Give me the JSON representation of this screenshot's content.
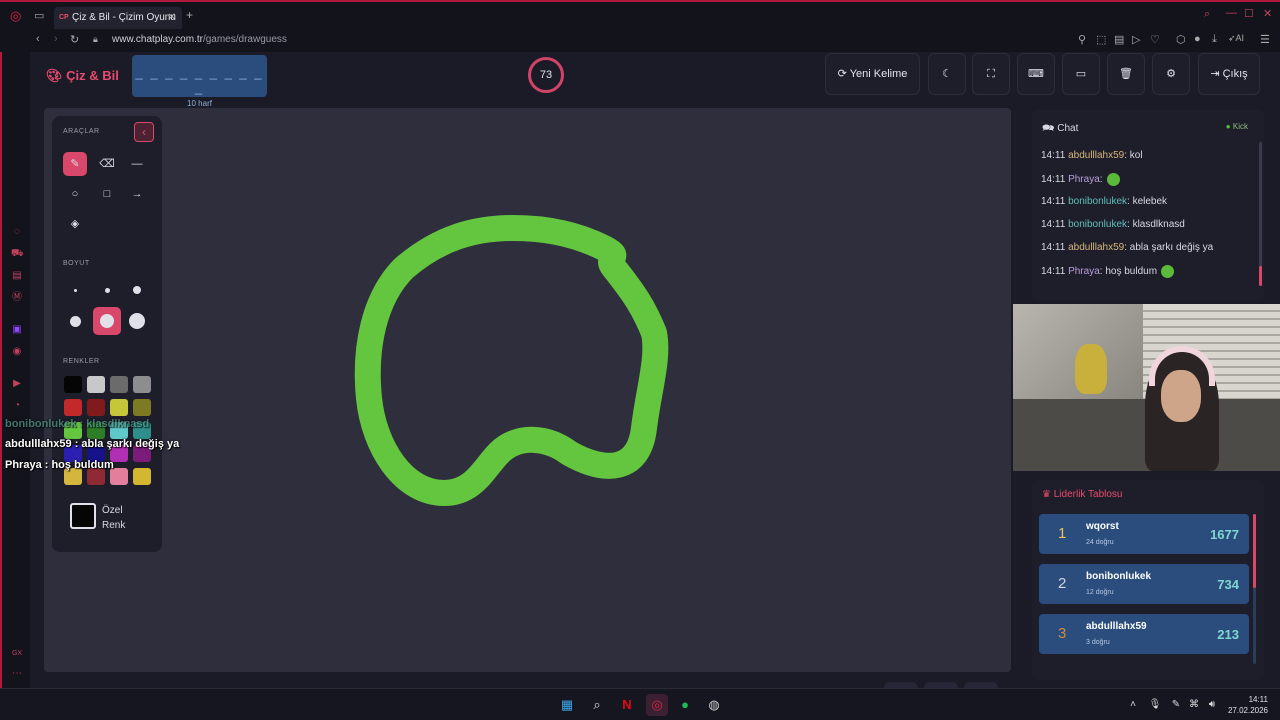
{
  "browser": {
    "tab_title": "Çiz & Bil - Çizim Oyunu",
    "tab_icon_text": "CP",
    "url_domain": "www.chatplay.com.tr",
    "url_path": "/games/drawguess",
    "ai_label": "AI"
  },
  "header": {
    "logo": "Çiz & Bil",
    "word_mask": "_ _ _ _ _ _ _ _ _ _",
    "word_hint": "10 harf",
    "timer": "73",
    "new_word": "Yeni Kelime",
    "exit": "Çıkış"
  },
  "tools": {
    "title": "ARAÇLAR",
    "size_title": "BOYUT",
    "colors_title": "RENKLER",
    "custom_color": "Özel",
    "custom_color2": "Renk",
    "swatches": [
      "#050505",
      "#c8c8c8",
      "#6b6b6b",
      "#8d8d8d",
      "#c3282a",
      "#801a1c",
      "#c6c63a",
      "#7c7b23",
      "#64c53e",
      "#2e7d27",
      "#5fc8c8",
      "#2f8f8d",
      "#2a1fb0",
      "#16128a",
      "#b12fb2",
      "#7b1c7a",
      "#d4b63e",
      "#8f2a35",
      "#e37e9d",
      "#d3b731"
    ]
  },
  "overlay": {
    "line1": "bonibonlukek : klasdlknasd",
    "line2": "abdulllahx59 : abla şarkı değiş ya",
    "line3": "Phraya : hoş buldum"
  },
  "chat": {
    "title": "Chat",
    "platform": "Kick",
    "messages": [
      {
        "time": "14:11",
        "user": "abdulllahx59",
        "text": ": kol"
      },
      {
        "time": "14:11",
        "user": "Phraya",
        "text": ":"
      },
      {
        "time": "14:11",
        "user": "bonibonlukek",
        "text": ": kelebek"
      },
      {
        "time": "14:11",
        "user": "bonibonlukek",
        "text": ": klasdlknasd"
      },
      {
        "time": "14:11",
        "user": "abdulllahx59",
        "text": ": abla şarkı değiş ya"
      },
      {
        "time": "14:11",
        "user": "Phraya",
        "text": ": hoş buldum"
      }
    ]
  },
  "leaderboard": {
    "title": "Liderlik Tablosu",
    "rows": [
      {
        "rank": "1",
        "name": "wqorst",
        "sub": "24 doğru",
        "score": "1677",
        "rank_color": "#e8c35a"
      },
      {
        "rank": "2",
        "name": "bonibonlukek",
        "sub": "12 doğru",
        "score": "734",
        "rank_color": "#cfd6e0"
      },
      {
        "rank": "3",
        "name": "abdulllahx59",
        "sub": "3 doğru",
        "score": "213",
        "rank_color": "#d58a3a"
      }
    ]
  },
  "taskbar": {
    "time": "14:11",
    "date": "27.02.2026"
  },
  "colors": {
    "accent": "#e64b6d",
    "stroke": "#64c53e",
    "panel": "#1e1e2b",
    "word_box": "#2b4d7d"
  }
}
